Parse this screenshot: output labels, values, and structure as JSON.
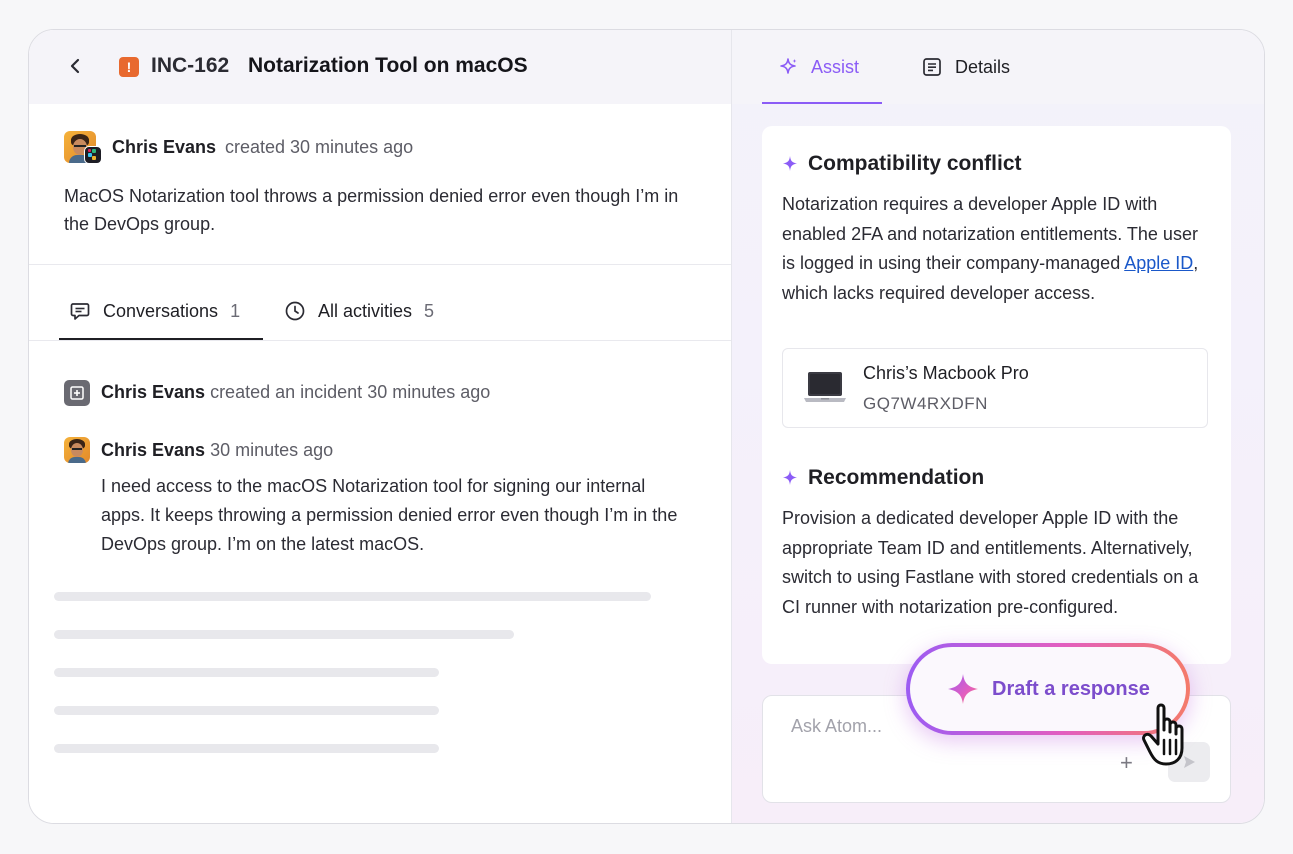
{
  "incident": {
    "id": "INC-162",
    "title": "Notarization Tool on macOS",
    "creator": "Chris Evans",
    "created_meta": "created 30 minutes ago",
    "description": "MacOS Notarization tool throws a permission denied error even though I’m in the DevOps group."
  },
  "tabs_left": [
    {
      "label": "Conversations",
      "count": "1"
    },
    {
      "label": "All activities",
      "count": "5"
    }
  ],
  "activity": {
    "who": "Chris Evans",
    "action": "created an incident",
    "time": "30 minutes ago"
  },
  "message": {
    "who": "Chris Evans",
    "time": "30 minutes ago",
    "text": "I need access to the macOS Notarization tool for signing our internal apps. It keeps throwing a permission denied error even though I’m in the DevOps group. I’m on the latest macOS."
  },
  "tabs_right": [
    {
      "label": "Assist"
    },
    {
      "label": "Details"
    }
  ],
  "assist": {
    "conflict_title": "Compatibility conflict",
    "conflict_text_before": "Notarization requires a developer Apple ID with enabled 2FA and notarization entitlements. The user is logged in using their company-managed ",
    "conflict_link": "Apple ID",
    "conflict_text_after": ", which lacks required developer access.",
    "device_name": "Chris’s Macbook Pro",
    "device_serial": "GQ7W4RXDFN",
    "recommendation_title": "Recommendation",
    "recommendation_text": "Provision a dedicated developer Apple ID with the appropriate Team ID and entitlements. Alternatively, switch to using Fastlane with stored credentials on a CI runner with notarization pre-configured."
  },
  "ask": {
    "placeholder": "Ask Atom...",
    "plus": "+"
  },
  "draft_button": "Draft a response",
  "colors": {
    "accent": "#8b5cf6",
    "alert": "#e8692f",
    "link": "#1a58c9"
  }
}
